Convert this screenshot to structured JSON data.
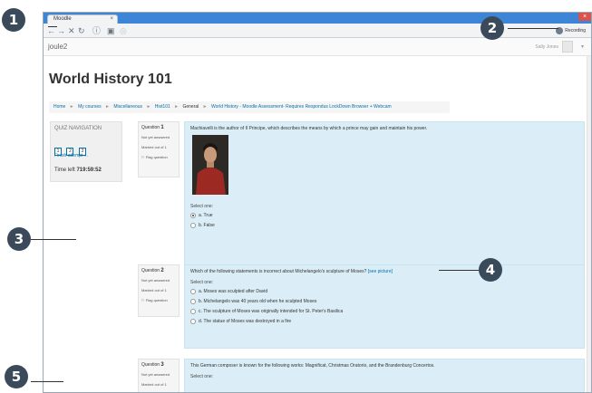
{
  "browser": {
    "tab_title": "Moodle",
    "tab_close": "×",
    "window_close": "×",
    "recording_label": "Recording",
    "nav_icons": [
      "←",
      "→",
      "✕",
      "↻",
      "ⓘ",
      "▣",
      "◎"
    ]
  },
  "header": {
    "site_name": "joule2",
    "user_name": "Sally Jones",
    "user_caret": "▾"
  },
  "page": {
    "title": "World History 101"
  },
  "breadcrumb": [
    {
      "label": "Home",
      "link": true
    },
    {
      "label": "My courses",
      "link": true
    },
    {
      "label": "Miscellaneous",
      "link": true
    },
    {
      "label": "Hist101",
      "link": true
    },
    {
      "label": "General",
      "link": false
    },
    {
      "label": "World History - Moodle Assessment- Requires Respondus LockDown Browser + Webcam",
      "link": true
    }
  ],
  "breadcrumb_sep": "►",
  "quiz_nav": {
    "title": "QUIZ NAVIGATION",
    "buttons": [
      "1",
      "2",
      "3"
    ],
    "finish": "Finish attempt ...",
    "time_label": "Time left",
    "time_value": "719:59:52"
  },
  "questions": [
    {
      "label": "Question",
      "number": "1",
      "status": "Not yet answered",
      "marks": "Marked out of 1",
      "flag": "Flag question",
      "text": "Machiavelli is the author of Il Principe, which describes the means by which a prince may gain and maintain his power.",
      "select_one": "Select one:",
      "options": [
        "a. True",
        "b. False"
      ],
      "selected": 0
    },
    {
      "label": "Question",
      "number": "2",
      "status": "Not yet answered",
      "marks": "Marked out of 1",
      "flag": "Flag question",
      "text": "Which of the following statements is incorrect about Michelangelo's sculpture of Moses?",
      "link": "[see picture]",
      "select_one": "Select one:",
      "options": [
        "a. Moses was sculpted after David",
        "b. Michelangelo was 40 years old when he sculpted Moses",
        "c. The sculpture of Moses was originally intended for St. Peter's Basilica",
        "d. The statue of Moses was destroyed in a fire"
      ]
    },
    {
      "label": "Question",
      "number": "3",
      "status": "Not yet answered",
      "marks": "Marked out of 1",
      "text": "This German composer is known for the following works: Magnificat, Christmas Oratorio, and the Brandenburg Concertos.",
      "select_one": "Select one:"
    }
  ],
  "callouts": [
    "1",
    "2",
    "3",
    "4",
    "5"
  ]
}
